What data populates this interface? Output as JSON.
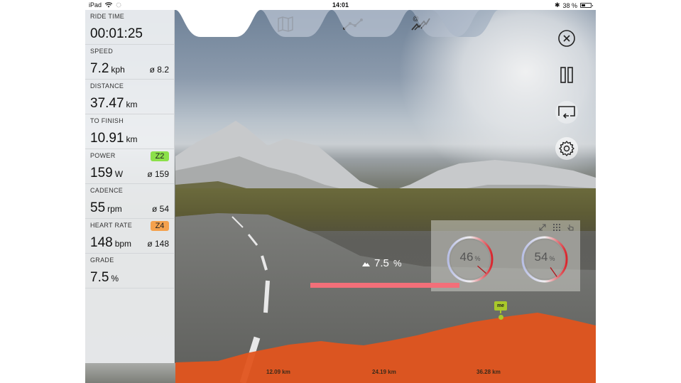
{
  "status_bar": {
    "device": "iPad",
    "time": "14:01",
    "battery": "38 %",
    "battery_level": 0.38
  },
  "tabs": [
    {
      "name": "video",
      "icon": "video-camera-icon",
      "active": true
    },
    {
      "name": "map",
      "icon": "map-icon",
      "active": false
    },
    {
      "name": "graph",
      "icon": "line-graph-icon",
      "active": false
    },
    {
      "name": "social",
      "icon": "at-graph-icon",
      "active": false
    }
  ],
  "metrics": {
    "ride_time": {
      "label": "RIDE TIME",
      "value": "00:01:25"
    },
    "speed": {
      "label": "SPEED",
      "value": "7.2",
      "unit": "kph",
      "avg": "ø 8.2"
    },
    "distance": {
      "label": "DISTANCE",
      "value": "37.47",
      "unit": "km"
    },
    "to_finish": {
      "label": "TO FINISH",
      "value": "10.91",
      "unit": "km"
    },
    "power": {
      "label": "POWER",
      "value": "159",
      "unit": "W",
      "avg": "ø 159",
      "zone": "Z2",
      "zone_color": "#8be04a"
    },
    "cadence": {
      "label": "CADENCE",
      "value": "55",
      "unit": "rpm",
      "avg": "ø 54"
    },
    "heart_rate": {
      "label": "HEART RATE",
      "value": "148",
      "unit": "bpm",
      "avg": "ø 148",
      "zone": "Z4",
      "zone_color": "#f4a14d"
    },
    "grade": {
      "label": "GRADE",
      "value": "7.5",
      "unit": "%"
    }
  },
  "controls": [
    {
      "name": "close-button",
      "icon": "close-circle-icon"
    },
    {
      "name": "pause-button",
      "icon": "pause-icon"
    },
    {
      "name": "return-button",
      "icon": "return-screen-icon"
    },
    {
      "name": "settings-button",
      "icon": "gear-icon"
    }
  ],
  "grade_indicator": {
    "value": "7.5",
    "unit": "%",
    "icon": "mountain-icon"
  },
  "gauges": [
    {
      "value": "46",
      "unit": "%",
      "fraction": 0.46
    },
    {
      "value": "54",
      "unit": "%",
      "fraction": 0.54
    }
  ],
  "gauge_panel_icons": [
    "expand-icon",
    "grid-icon",
    "touch-icon"
  ],
  "elevation": {
    "color": "#e2541d",
    "marker_label": "me",
    "km_labels": [
      "12.09 km",
      "24.19 km",
      "36.28 km"
    ]
  }
}
